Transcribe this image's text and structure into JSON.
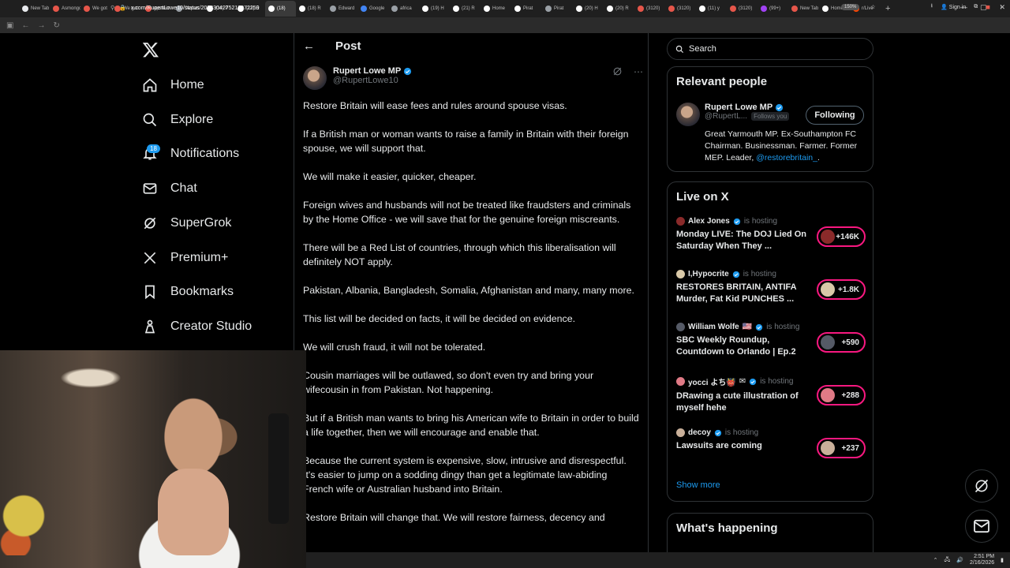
{
  "browser": {
    "tabs": [
      {
        "label": "New Tab",
        "color": "#e8eaed"
      },
      {
        "label": "Asmongold",
        "color": "#e6564a"
      },
      {
        "label": "We got",
        "color": "#e6564a"
      },
      {
        "label": "We got",
        "color": "#e6564a"
      },
      {
        "label": "epstein",
        "color": "#e6564a"
      },
      {
        "label": "Depart",
        "color": "#9aa0a6"
      },
      {
        "label": "(18) P",
        "color": "#ffffff"
      },
      {
        "label": "(18) R",
        "color": "#ffffff"
      },
      {
        "label": "(18)",
        "color": "#ffffff"
      },
      {
        "label": "(18) R",
        "color": "#ffffff"
      },
      {
        "label": "Edward",
        "color": "#9aa0a6"
      },
      {
        "label": "Google",
        "color": "#4285f4"
      },
      {
        "label": "africa",
        "color": "#9aa0a6"
      },
      {
        "label": "(19) H",
        "color": "#ffffff"
      },
      {
        "label": "(21) R",
        "color": "#ffffff"
      },
      {
        "label": "Home",
        "color": "#ffffff"
      },
      {
        "label": "Pirat",
        "color": "#ffffff"
      },
      {
        "label": "Pirat",
        "color": "#9aa0a6"
      },
      {
        "label": "(20) H",
        "color": "#ffffff"
      },
      {
        "label": "(20) R",
        "color": "#ffffff"
      },
      {
        "label": "(3120)",
        "color": "#e6564a"
      },
      {
        "label": "(3120)",
        "color": "#e6564a"
      },
      {
        "label": "(11) y",
        "color": "#ffffff"
      },
      {
        "label": "(3120)",
        "color": "#e6564a"
      },
      {
        "label": "(99+)",
        "color": "#a142f4"
      },
      {
        "label": "New Tab",
        "color": "#e6564a"
      },
      {
        "label": "Home",
        "color": "#ffffff"
      },
      {
        "label": "r/Live",
        "color": "#ff4500"
      }
    ],
    "active_tab_index": 8,
    "url": "x.com/RupertLowe10/status/2023304275217072259",
    "zoom": "150%",
    "sign_in": "Sign in"
  },
  "nav": {
    "items": [
      {
        "label": "Home",
        "icon": "home-icon"
      },
      {
        "label": "Explore",
        "icon": "search-icon"
      },
      {
        "label": "Notifications",
        "icon": "bell-icon"
      },
      {
        "label": "Chat",
        "icon": "mail-icon"
      },
      {
        "label": "SuperGrok",
        "icon": "grok-icon"
      },
      {
        "label": "Premium+",
        "icon": "x-icon"
      },
      {
        "label": "Bookmarks",
        "icon": "bookmark-icon"
      },
      {
        "label": "Creator Studio",
        "icon": "flask-icon"
      }
    ],
    "notification_count": "18"
  },
  "post": {
    "header_title": "Post",
    "author_name": "Rupert Lowe MP",
    "author_handle": "@RupertLowe10",
    "paragraphs": [
      "Restore Britain will ease fees and rules around spouse visas.",
      "If a British man or woman wants to raise a family in Britain with their foreign spouse, we will support that.",
      "We will make it easier, quicker, cheaper.",
      "Foreign wives and husbands will not be treated like fraudsters and criminals by the Home Office - we will save that for the genuine foreign miscreants.",
      "There will be a Red List of countries, through which this liberalisation will definitely NOT apply.",
      "Pakistan, Albania, Bangladesh, Somalia, Afghanistan and many, many more.",
      "This list will be decided on facts, it will be decided on evidence.",
      "We will crush fraud, it will not be tolerated.",
      "Cousin marriages will be outlawed, so don't even try and bring your wifecousin in from Pakistan. Not happening.",
      "But if a British man wants to bring his American wife to Britain in order to build a life together, then we will encourage and enable that.",
      "Because the current system is expensive, slow, intrusive and disrespectful. It's easier to jump on a sodding dingy than get a legitimate law-abiding French wife or Australian husband into Britain.",
      "Restore Britain will change that. We will restore fairness, decency and"
    ]
  },
  "search": {
    "placeholder": "Search"
  },
  "relevant_people": {
    "title": "Relevant people",
    "name": "Rupert Lowe MP",
    "handle": "@RupertL...",
    "follows_you": "Follows you",
    "button": "Following",
    "bio": "Great Yarmouth MP. Ex-Southampton FC Chairman. Businessman. Farmer. Former MEP. Leader,",
    "bio_link": "@restorebritain_",
    "bio_tail": "."
  },
  "live": {
    "title": "Live on X",
    "status": "is hosting",
    "items": [
      {
        "host": "Alex Jones",
        "verified": true,
        "flag": "",
        "title": "Monday LIVE: The DOJ Lied On Saturday When They ...",
        "count": "+146K",
        "av_color": "#8a2a2a"
      },
      {
        "host": "I,Hypocrite",
        "verified": true,
        "flag": "",
        "title": "RESTORES BRITAIN, ANTIFA Murder, Fat Kid PUNCHES ...",
        "count": "+1.8K",
        "av_color": "#d9c9a8"
      },
      {
        "host": "William Wolfe",
        "verified": true,
        "flag": "🇺🇸",
        "title": "SBC Weekly Roundup, Countdown to Orlando | Ep.2",
        "count": "+590",
        "av_color": "#555a66"
      },
      {
        "host": "yocci よち👹",
        "verified": true,
        "flag": "✉",
        "title": "DRawing a cute illustration of myself hehe",
        "count": "+288",
        "av_color": "#e07a86"
      },
      {
        "host": "decoy",
        "verified": true,
        "flag": "",
        "title": "Lawsuits are coming",
        "count": "+237",
        "av_color": "#c9b09a"
      }
    ],
    "show_more": "Show more"
  },
  "whats_happening": {
    "title": "What's happening"
  },
  "taskbar": {
    "time": "2:51 PM",
    "date": "2/16/2026"
  },
  "colors": {
    "accent": "#1d9bf0",
    "live_ring": "#f91880",
    "border": "#2f3336",
    "muted": "#71767b"
  }
}
